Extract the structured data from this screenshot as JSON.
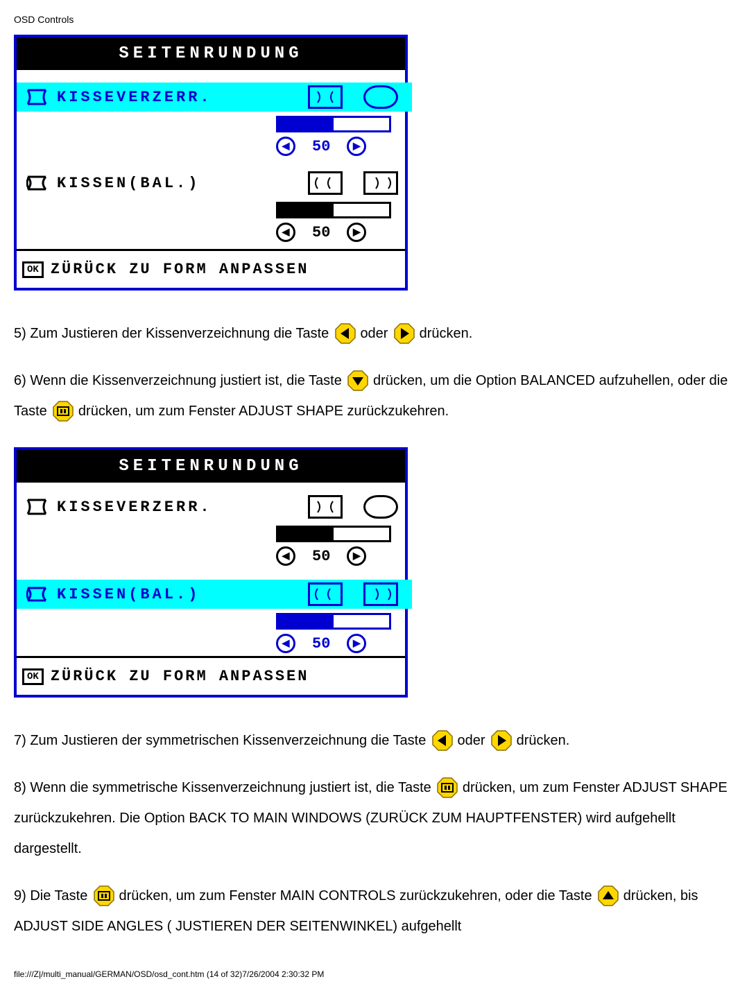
{
  "page_header": "OSD Controls",
  "osd1": {
    "title": "SEITENRUNDUNG",
    "item1": {
      "label": "KISSEVERZERR.",
      "value": "50",
      "selected": true
    },
    "item2": {
      "label": "KISSEN(BAL.)",
      "value": "50",
      "selected": false
    },
    "footer_ok": "OK",
    "footer_text": "ZÜRÜCK ZU FORM ANPASSEN"
  },
  "osd2": {
    "title": "SEITENRUNDUNG",
    "item1": {
      "label": "KISSEVERZERR.",
      "value": "50",
      "selected": false
    },
    "item2": {
      "label": "KISSEN(BAL.)",
      "value": "50",
      "selected": true
    },
    "footer_ok": "OK",
    "footer_text": "ZÜRÜCK ZU FORM ANPASSEN"
  },
  "steps": {
    "s5a": "5) Zum Justieren der Kissenverzeichnung die Taste ",
    "s5b": " oder ",
    "s5c": " drücken.",
    "s6a": "6) Wenn die Kissenverzeichnung justiert ist, die Taste ",
    "s6b": " drücken, um die Option BALANCED aufzuhellen, oder die Taste ",
    "s6c": " drücken, um zum Fenster ADJUST SHAPE zurückzukehren.",
    "s7a": "7) Zum Justieren der symmetrischen Kissenverzeichnung die Taste ",
    "s7b": " oder ",
    "s7c": " drücken.",
    "s8a": "8) Wenn die symmetrische Kissenverzeichnung justiert ist, die Taste ",
    "s8b": " drücken, um zum Fenster ADJUST SHAPE zurückzukehren. Die Option BACK TO MAIN WINDOWS (ZURÜCK ZUM HAUPTFENSTER) wird aufgehellt dargestellt.",
    "s9a": "9) Die Taste ",
    "s9b": " drücken, um zum Fenster MAIN CONTROLS zurückzukehren, oder die Taste ",
    "s9c": " drücken, bis ADJUST SIDE ANGLES ( JUSTIEREN DER SEITENWINKEL) aufgehellt",
    "word_oder": "oder"
  },
  "footer_line": "file:///Z|/multi_manual/GERMAN/OSD/osd_cont.htm (14 of 32)7/26/2004 2:30:32 PM"
}
